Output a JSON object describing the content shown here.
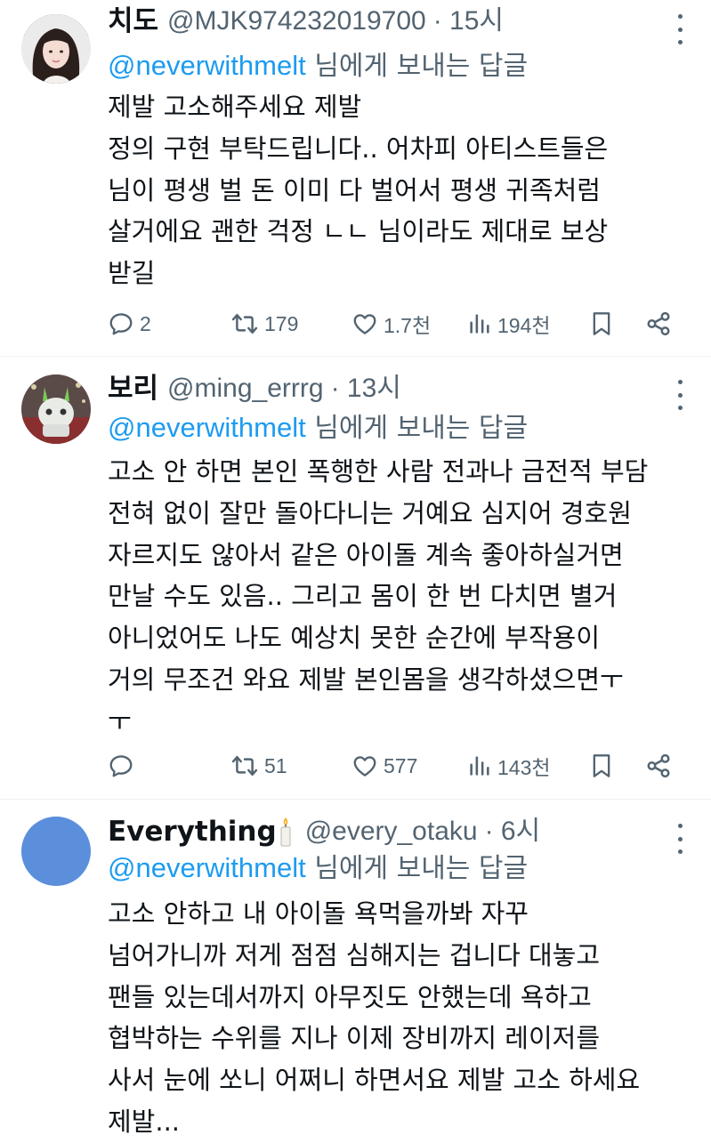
{
  "tweets": [
    {
      "name": "치도",
      "handle": "@MJK974232019700",
      "time": "· 15시",
      "reply_handle": "@neverwithmelt",
      "reply_suffix": " 님에게 보내는 답글",
      "lines": [
        "제발 고소해주세요 제발",
        "정의 구현 부탁드립니다.. 어차피 아티스트들은",
        "님이 평생 벌 돈 이미 다 벌어서 평생 귀족처럼",
        "살거에요 괜한 걱정 ㄴㄴ 님이라도 제대로 보상",
        "받길"
      ],
      "replies": "2",
      "retweets": "179",
      "likes": "1.7천",
      "views": "194천"
    },
    {
      "name": "보리",
      "handle": "@ming_errrg",
      "time": "· 13시",
      "reply_handle": "@neverwithmelt",
      "reply_suffix": " 님에게 보내는 답글",
      "lines": [
        "고소 안 하면 본인 폭행한 사람 전과나 금전적 부담",
        "전혀 없이 잘만 돌아다니는 거예요 심지어 경호원",
        "자르지도 않아서 같은 아이돌 계속 좋아하실거면",
        "만날 수도 있음.. 그리고 몸이 한 번 다치면 별거",
        "아니었어도 나도 예상치 못한 순간에 부작용이",
        "거의 무조건 와요 제발 본인몸을 생각하셨으면ㅜ",
        "ㅜ"
      ],
      "replies": "",
      "retweets": "51",
      "likes": "577",
      "views": "143천"
    },
    {
      "name": "Everything",
      "handle": "@every_otaku",
      "time": "· 6시",
      "reply_handle": "@neverwithmelt",
      "reply_suffix": " 님에게 보내는 답글",
      "lines": [
        "고소 안하고 내 아이돌 욕먹을까봐 자꾸",
        "넘어가니까 저게 점점 심해지는 겁니다 대놓고",
        "팬들 있는데서까지 아무짓도 안했는데 욕하고",
        "협박하는 수위를 지나 이제 장비까지 레이저를",
        "사서 눈에 쏘니 어쩌니 하면서요 제발 고소 하세요",
        "제발..."
      ]
    }
  ],
  "colors": {
    "link": "#1d9bf0",
    "muted": "#536471",
    "text": "#0f1419",
    "avatar3": "#5b8fdc"
  },
  "icons": [
    "reply-icon",
    "retweet-icon",
    "like-icon",
    "views-icon",
    "bookmark-icon",
    "share-icon",
    "more-icon",
    "candle-emoji"
  ]
}
